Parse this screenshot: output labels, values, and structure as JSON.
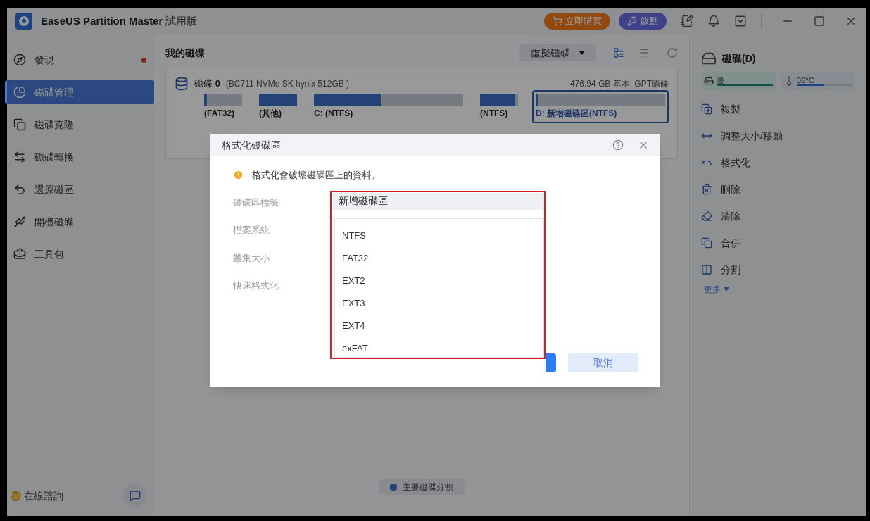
{
  "app": {
    "title": "EaseUS Partition Master",
    "edition": "試用版",
    "buy": "立即購買",
    "activate": "啟動"
  },
  "sidebar": {
    "items": [
      {
        "label": "發現",
        "selected": false,
        "dot": true
      },
      {
        "label": "磁碟管理",
        "selected": true,
        "dot": false
      },
      {
        "label": "磁碟克隆",
        "selected": false,
        "dot": false
      },
      {
        "label": "磁碟轉換",
        "selected": false,
        "dot": false
      },
      {
        "label": "還原磁區",
        "selected": false,
        "dot": false
      },
      {
        "label": "開機磁碟",
        "selected": false,
        "dot": false
      },
      {
        "label": "工具包",
        "selected": false,
        "dot": false
      }
    ],
    "consult": "在線諮詢"
  },
  "main": {
    "title": "我的磁碟",
    "view": "虛擬磁碟",
    "disk": {
      "name": "磁碟",
      "number": "0",
      "model": "(BC711 NVMe SK hynix 512GB )",
      "summary": "476.94 GB 基本, GPT磁碟",
      "partitions": [
        {
          "label": "(FAT32)",
          "level": 0.08,
          "selected": false
        },
        {
          "label": "(其他)",
          "level": 1,
          "selected": false
        },
        {
          "label": "C: (NTFS)",
          "level": 0.45,
          "selected": false
        },
        {
          "label": "(NTFS)",
          "level": 0.93,
          "selected": false
        },
        {
          "label": "D: 新增磁碟區(NTFS)",
          "level": 0.01,
          "selected": true
        }
      ]
    },
    "legend": "主要磁碟分割"
  },
  "details": {
    "disk": "磁碟(D)",
    "health": {
      "label": "優",
      "level": 1
    },
    "temperature": {
      "label": "36°C",
      "level": 0.5
    },
    "actions": [
      "複製",
      "調整大小/移動",
      "格式化",
      "刪除",
      "清除",
      "合併",
      "分割"
    ],
    "more": "更多"
  },
  "dialog": {
    "title": "格式化磁碟區",
    "warning": "格式化會破壞磁碟區上的資料。",
    "fields": [
      "磁碟區標籤",
      "檔案系統",
      "叢集大小",
      "快速格式化"
    ],
    "volume_label": "新增磁碟區",
    "file_systems": [
      "NTFS",
      "FAT32",
      "EXT2",
      "EXT3",
      "EXT4",
      "exFAT"
    ],
    "cancel": "取消"
  }
}
